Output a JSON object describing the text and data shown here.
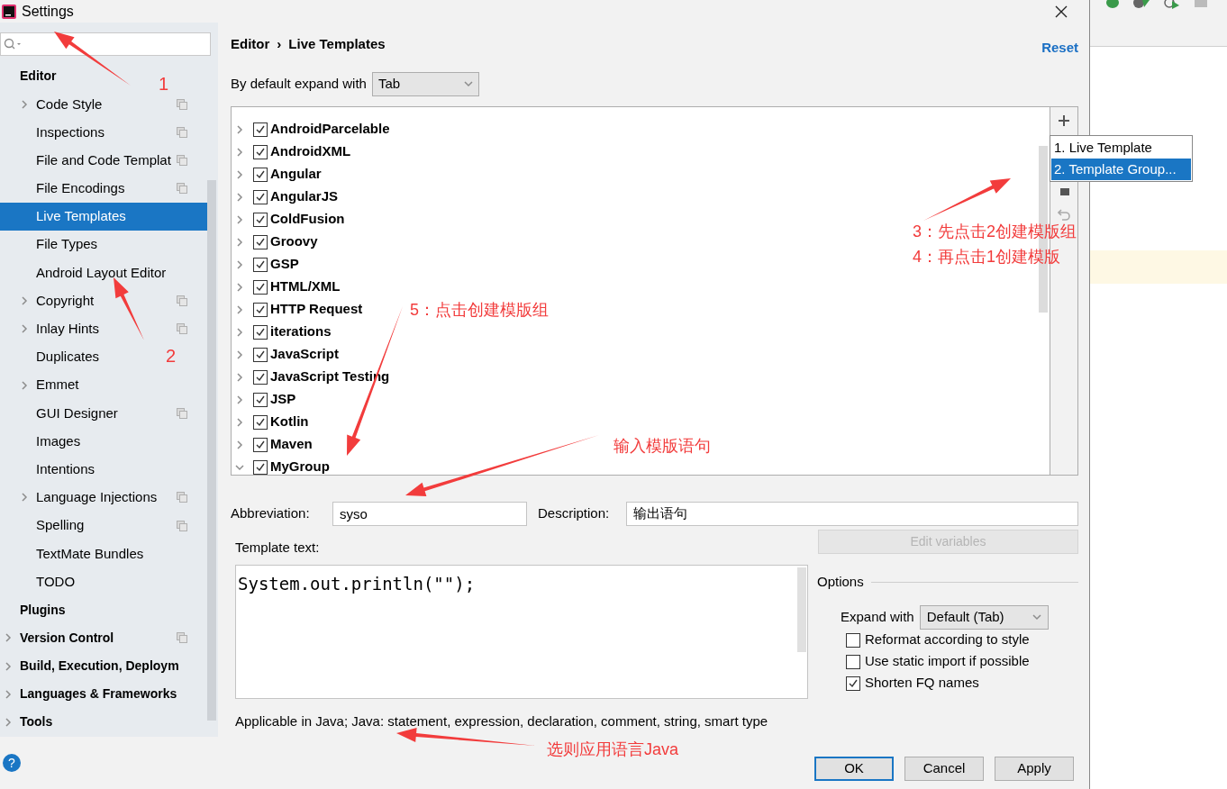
{
  "window": {
    "title": "Settings"
  },
  "sidebar": {
    "items": [
      {
        "label": "Editor",
        "expandable": false,
        "selected": false,
        "project_scope": false,
        "children": [
          {
            "label": "Code Style",
            "expandable": true,
            "selected": false,
            "project_scope": true
          },
          {
            "label": "Inspections",
            "expandable": false,
            "selected": false,
            "project_scope": true
          },
          {
            "label": "File and Code Templat",
            "expandable": false,
            "selected": false,
            "project_scope": true
          },
          {
            "label": "File Encodings",
            "expandable": false,
            "selected": false,
            "project_scope": true
          },
          {
            "label": "Live Templates",
            "expandable": false,
            "selected": true,
            "project_scope": false
          },
          {
            "label": "File Types",
            "expandable": false,
            "selected": false,
            "project_scope": false
          },
          {
            "label": "Android Layout Editor",
            "expandable": false,
            "selected": false,
            "project_scope": false
          },
          {
            "label": "Copyright",
            "expandable": true,
            "selected": false,
            "project_scope": true
          },
          {
            "label": "Inlay Hints",
            "expandable": true,
            "selected": false,
            "project_scope": true
          },
          {
            "label": "Duplicates",
            "expandable": false,
            "selected": false,
            "project_scope": false
          },
          {
            "label": "Emmet",
            "expandable": true,
            "selected": false,
            "project_scope": false
          },
          {
            "label": "GUI Designer",
            "expandable": false,
            "selected": false,
            "project_scope": true
          },
          {
            "label": "Images",
            "expandable": false,
            "selected": false,
            "project_scope": false
          },
          {
            "label": "Intentions",
            "expandable": false,
            "selected": false,
            "project_scope": false
          },
          {
            "label": "Language Injections",
            "expandable": true,
            "selected": false,
            "project_scope": true
          },
          {
            "label": "Spelling",
            "expandable": false,
            "selected": false,
            "project_scope": true
          },
          {
            "label": "TextMate Bundles",
            "expandable": false,
            "selected": false,
            "project_scope": false
          },
          {
            "label": "TODO",
            "expandable": false,
            "selected": false,
            "project_scope": false
          }
        ]
      },
      {
        "label": "Plugins",
        "expandable": false,
        "selected": false,
        "project_scope": false
      },
      {
        "label": "Version Control",
        "expandable": true,
        "selected": false,
        "project_scope": true
      },
      {
        "label": "Build, Execution, Deploym",
        "expandable": true,
        "selected": false,
        "project_scope": false
      },
      {
        "label": "Languages & Frameworks",
        "expandable": true,
        "selected": false,
        "project_scope": false
      },
      {
        "label": "Tools",
        "expandable": true,
        "selected": false,
        "project_scope": false
      }
    ]
  },
  "breadcrumb": [
    "Editor",
    "›",
    "Live Templates"
  ],
  "reset": "Reset",
  "expand_default": {
    "label": "By default expand with",
    "value": "Tab"
  },
  "template_groups": [
    {
      "label": "AndroidParcelable",
      "checked": true,
      "expanded": false
    },
    {
      "label": "AndroidXML",
      "checked": true,
      "expanded": false
    },
    {
      "label": "Angular",
      "checked": true,
      "expanded": false
    },
    {
      "label": "AngularJS",
      "checked": true,
      "expanded": false
    },
    {
      "label": "ColdFusion",
      "checked": true,
      "expanded": false
    },
    {
      "label": "Groovy",
      "checked": true,
      "expanded": false
    },
    {
      "label": "GSP",
      "checked": true,
      "expanded": false
    },
    {
      "label": "HTML/XML",
      "checked": true,
      "expanded": false
    },
    {
      "label": "HTTP Request",
      "checked": true,
      "expanded": false
    },
    {
      "label": "iterations",
      "checked": true,
      "expanded": false
    },
    {
      "label": "JavaScript",
      "checked": true,
      "expanded": false
    },
    {
      "label": "JavaScript Testing",
      "checked": true,
      "expanded": false
    },
    {
      "label": "JSP",
      "checked": true,
      "expanded": false
    },
    {
      "label": "Kotlin",
      "checked": true,
      "expanded": false
    },
    {
      "label": "Maven",
      "checked": true,
      "expanded": false
    },
    {
      "label": "MyGroup",
      "checked": true,
      "expanded": true
    }
  ],
  "add_menu": [
    {
      "label": "1. Live Template",
      "selected": false
    },
    {
      "label": "2. Template Group...",
      "selected": true
    }
  ],
  "abbreviation": {
    "label": "Abbreviation:",
    "value": "syso"
  },
  "description": {
    "label": "Description:",
    "value": "输出语句"
  },
  "template_text": {
    "label": "Template text:",
    "code": "System.out.println(\"\");"
  },
  "edit_variables": {
    "label": "Edit variables",
    "disabled": true
  },
  "options": {
    "title": "Options",
    "expand_with": {
      "label": "Expand with",
      "value": "Default (Tab)"
    },
    "checkboxes": [
      {
        "label": "Reformat according to style",
        "checked": false
      },
      {
        "label": "Use static import if possible",
        "checked": false
      },
      {
        "label": "Shorten FQ names",
        "checked": true
      }
    ]
  },
  "applicable": "Applicable in Java; Java: statement, expression, declaration, comment, string, smart type",
  "help": "?",
  "buttons": [
    {
      "label": "OK",
      "default": true
    },
    {
      "label": "Cancel",
      "default": false
    },
    {
      "label": "Apply",
      "default": false
    }
  ],
  "annotations": [
    {
      "text": "1"
    },
    {
      "text": "2"
    },
    {
      "text": "3：先点击2创建模版组"
    },
    {
      "text": "4：再点击1创建模版"
    },
    {
      "text": "5：点击创建模版组"
    },
    {
      "text": "输入模版语句"
    },
    {
      "text": "选则应用语言Java"
    }
  ]
}
